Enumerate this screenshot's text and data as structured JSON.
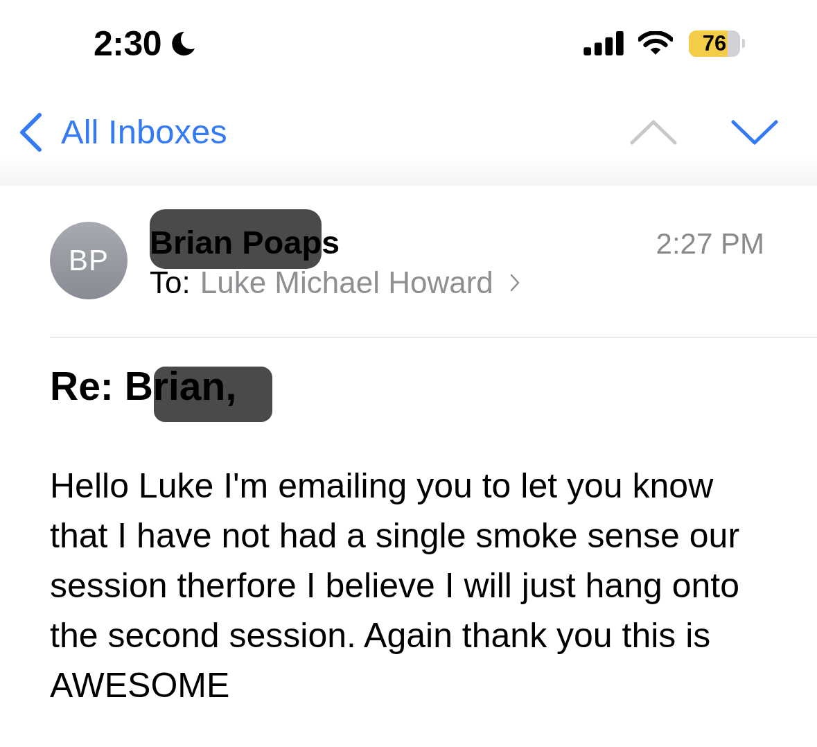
{
  "status_bar": {
    "time": "2:30",
    "battery_percent": "76"
  },
  "nav_bar": {
    "back": {
      "label": "All Inboxes"
    },
    "arrows": [
      {
        "kind": "previous",
        "disabled": true
      },
      {
        "kind": "next",
        "disabled": false
      }
    ]
  },
  "message": {
    "sender": {
      "initials": "BP",
      "name": "Brian Poaps",
      "redacted": true
    },
    "to_label": "To:",
    "recipient": "Luke Michael Howard",
    "time": "2:27 PM",
    "subject": {
      "text": "Re: Brian,",
      "redacted": true
    },
    "body": "Hello Luke I'm emailing you to let you know that I have not had a single smoke sense our session therfore I believe I will just hang onto the second session. Again thank you this is AWESOME"
  }
}
